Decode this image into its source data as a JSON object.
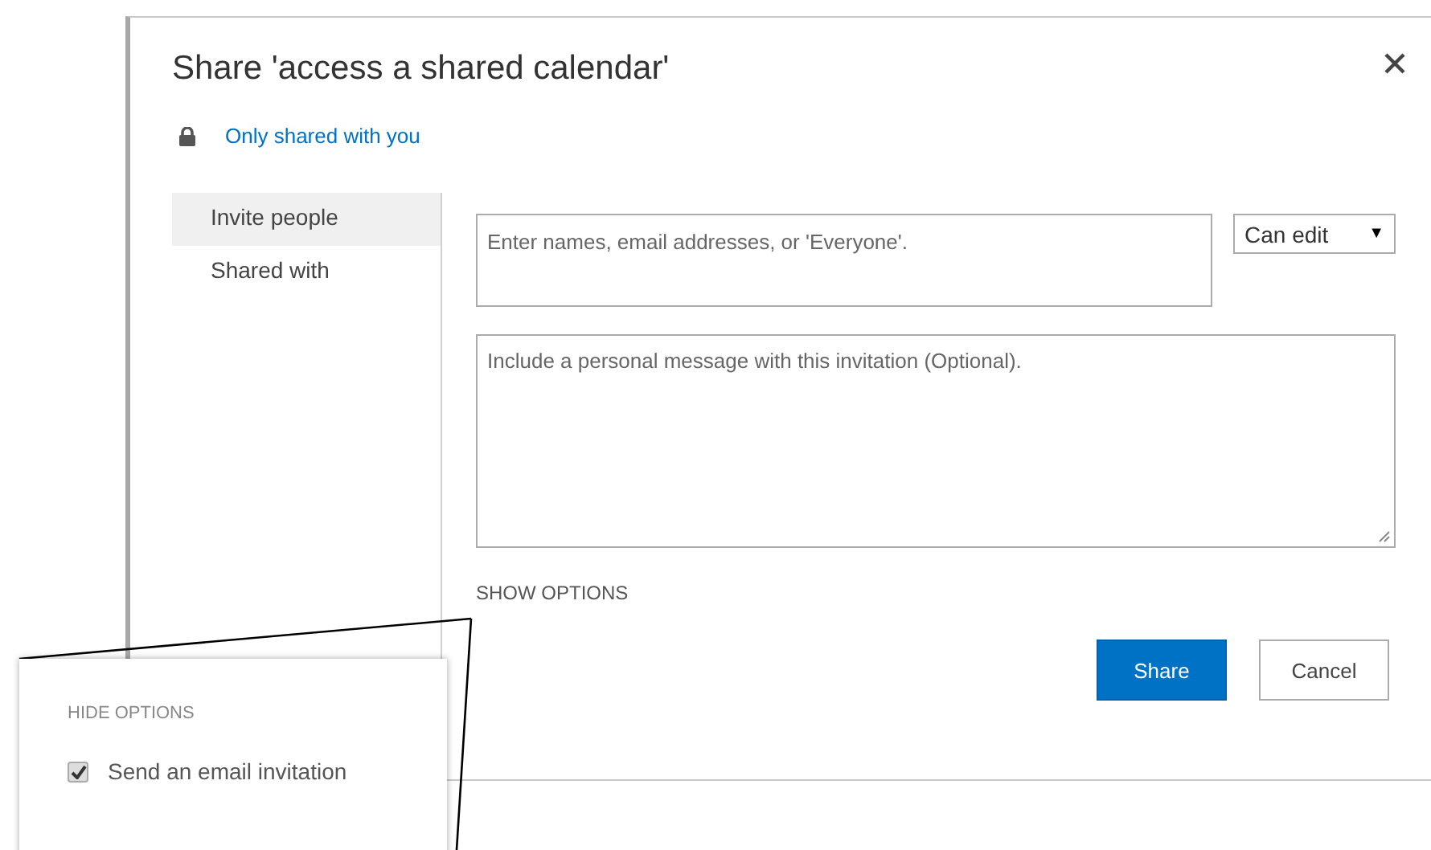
{
  "dialog": {
    "title": "Share 'access a shared calendar'",
    "sharing_status": "Only shared with you",
    "tabs": [
      {
        "label": "Invite people",
        "selected": true
      },
      {
        "label": "Shared with",
        "selected": false
      }
    ],
    "invite_field": {
      "placeholder": "Enter names, email addresses, or 'Everyone'."
    },
    "permission": {
      "value": "Can edit",
      "arrow": "▼"
    },
    "message_field": {
      "placeholder": "Include a personal message with this invitation (Optional)."
    },
    "show_options": "SHOW OPTIONS",
    "buttons": [
      {
        "label": "Share",
        "kind": "primary"
      },
      {
        "label": "Cancel",
        "kind": "secondary"
      }
    ]
  },
  "callout": {
    "hide_options": "HIDE OPTIONS",
    "options": [
      {
        "label": "Send an email invitation",
        "checked": true
      }
    ]
  }
}
